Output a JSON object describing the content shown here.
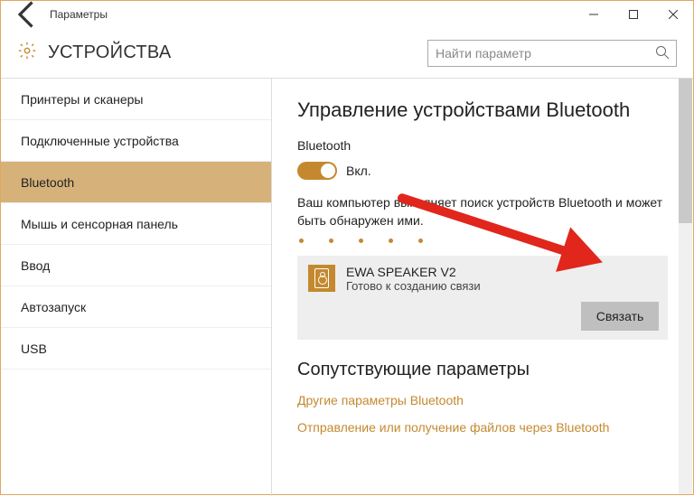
{
  "titlebar": {
    "title": "Параметры"
  },
  "header": {
    "title": "УСТРОЙСТВА",
    "search_placeholder": "Найти параметр"
  },
  "sidebar": {
    "items": [
      {
        "label": "Принтеры и сканеры",
        "active": false
      },
      {
        "label": "Подключенные устройства",
        "active": false
      },
      {
        "label": "Bluetooth",
        "active": true
      },
      {
        "label": "Мышь и сенсорная панель",
        "active": false
      },
      {
        "label": "Ввод",
        "active": false
      },
      {
        "label": "Автозапуск",
        "active": false
      },
      {
        "label": "USB",
        "active": false
      }
    ]
  },
  "main": {
    "heading": "Управление устройствами Bluetooth",
    "bt_label": "Bluetooth",
    "toggle_state": "Вкл.",
    "status": "Ваш компьютер выполняет поиск устройств Bluetooth и может быть обнаружен ими.",
    "device": {
      "name": "EWA SPEAKER V2",
      "status": "Готово к созданию связи",
      "pair_button": "Связать"
    },
    "related_heading": "Сопутствующие параметры",
    "links": [
      "Другие параметры Bluetooth",
      "Отправление или получение файлов через Bluetooth"
    ]
  },
  "colors": {
    "accent": "#c4892f",
    "selected": "#d6b27a",
    "arrow": "#e1261c"
  }
}
